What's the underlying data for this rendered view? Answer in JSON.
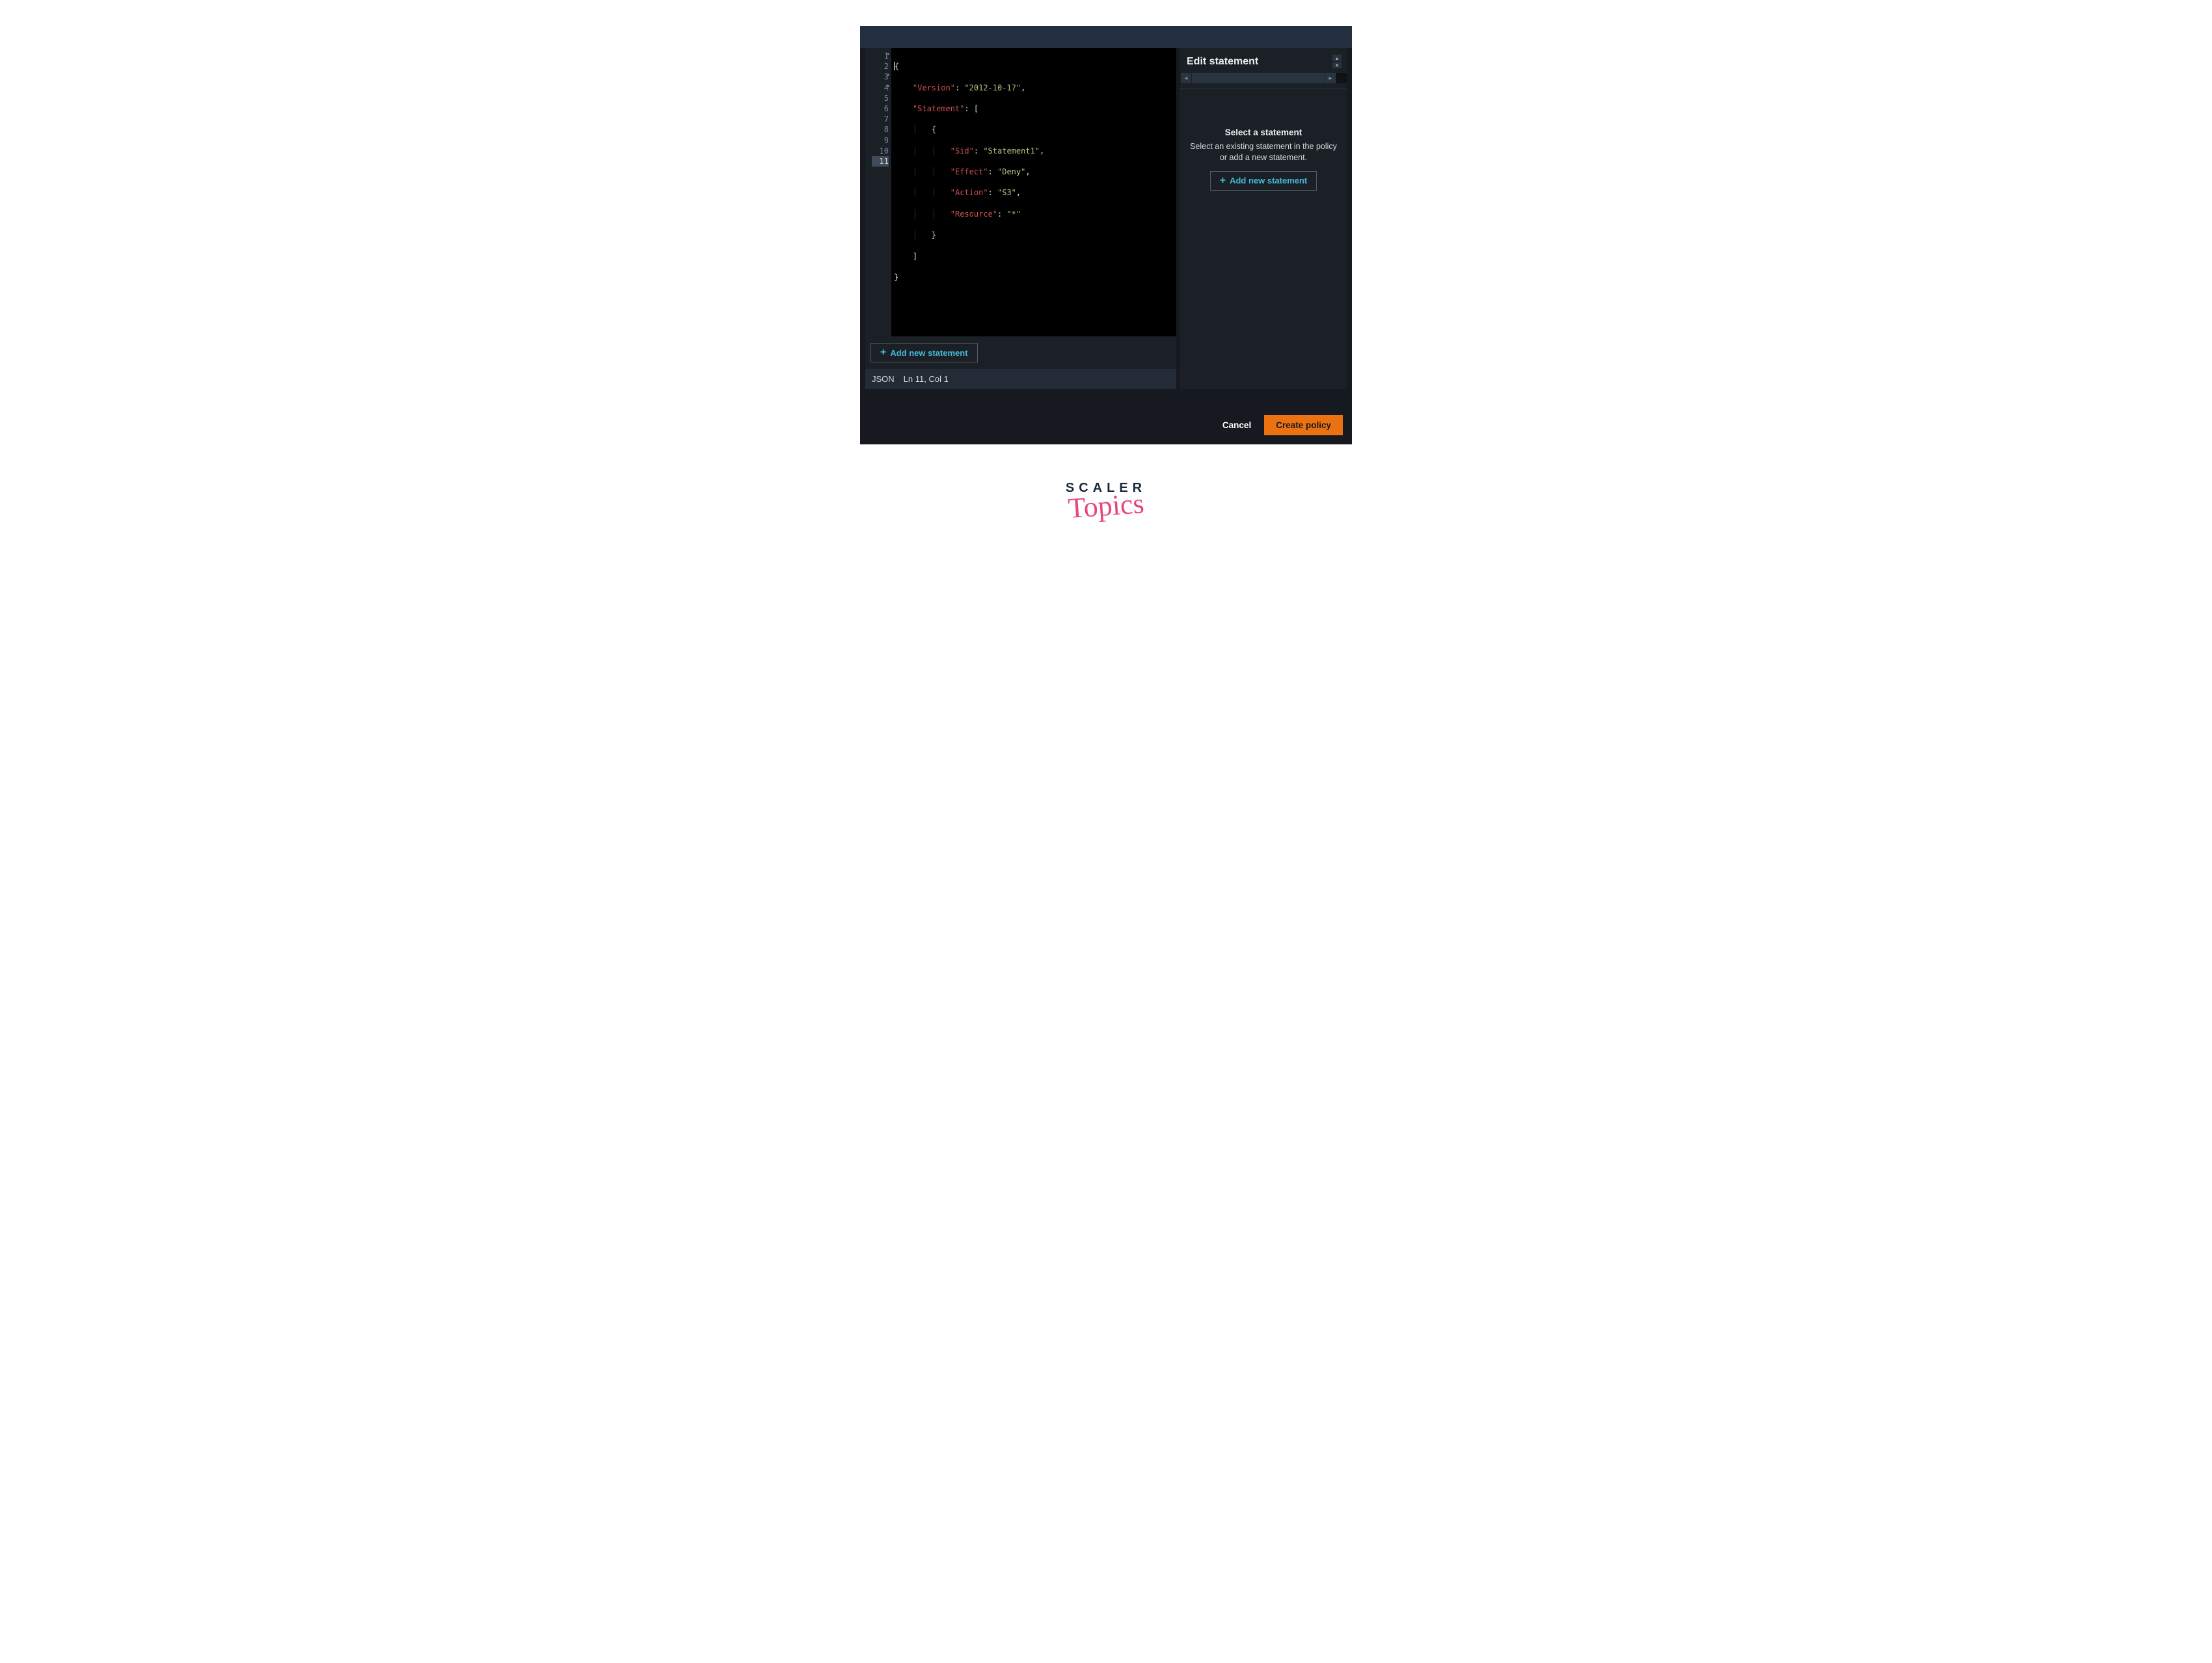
{
  "editor": {
    "lines": [
      {
        "num": 1,
        "foldable": true
      },
      {
        "num": 2
      },
      {
        "num": 3,
        "foldable": true
      },
      {
        "num": 4,
        "foldable": true
      },
      {
        "num": 5
      },
      {
        "num": 6
      },
      {
        "num": 7
      },
      {
        "num": 8
      },
      {
        "num": 9
      },
      {
        "num": 10
      },
      {
        "num": 11,
        "current": true
      }
    ],
    "code_json": {
      "Version": "2012-10-17",
      "Statement": [
        {
          "Sid": "Statement1",
          "Effect": "Deny",
          "Action": "S3",
          "Resource": "*"
        }
      ]
    },
    "keys": {
      "version": "\"Version\"",
      "statement": "\"Statement\"",
      "sid": "\"Sid\"",
      "effect": "\"Effect\"",
      "action": "\"Action\"",
      "resource": "\"Resource\""
    },
    "vals": {
      "version": "\"2012-10-17\"",
      "sid": "\"Statement1\"",
      "effect": "\"Deny\"",
      "action": "\"S3\"",
      "resource": "\"*\""
    },
    "add_button": "Add new statement",
    "status_mode": "JSON",
    "status_pos": "Ln 11, Col 1"
  },
  "side": {
    "title": "Edit statement",
    "empty_title": "Select a statement",
    "empty_body": "Select an existing statement in the policy or add a new statement.",
    "add_button": "Add new statement"
  },
  "footer": {
    "cancel": "Cancel",
    "create": "Create policy"
  },
  "logo": {
    "line1": "SCALER",
    "line2": "Topics"
  }
}
